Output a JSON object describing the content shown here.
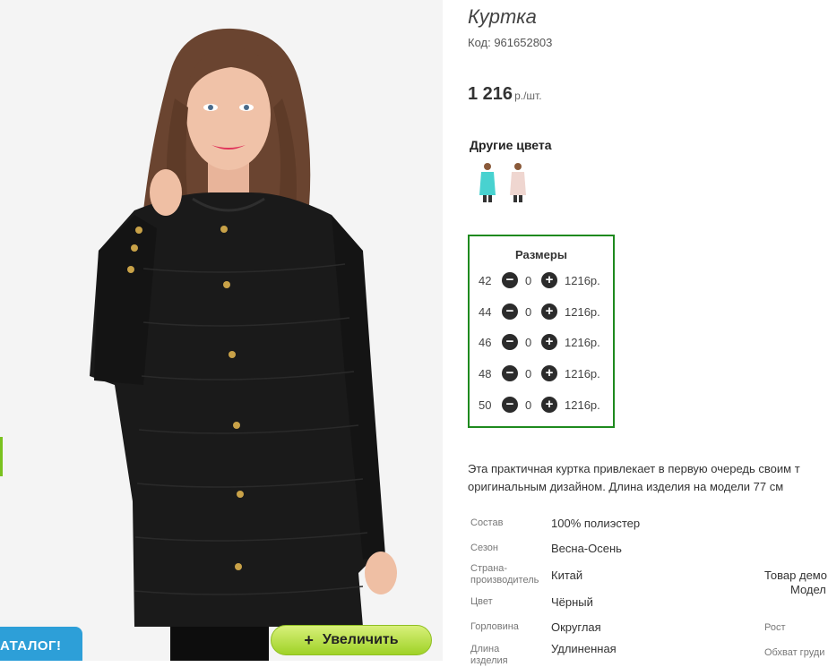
{
  "photo": {
    "catalog_badge": "АТАЛОГ!",
    "zoom_button": "Увеличить",
    "zoom_icon": "plus-icon"
  },
  "product": {
    "title": "Куртка",
    "code": "Код: 961652803",
    "price": "1 216",
    "price_unit": "р./шт."
  },
  "other_colors": {
    "title": "Другие цвета",
    "swatches": [
      "#48d2d0",
      "#efd6d0"
    ]
  },
  "sizes": {
    "title": "Размеры",
    "rows": [
      {
        "size": "42",
        "qty": "0",
        "price": "1216р."
      },
      {
        "size": "44",
        "qty": "0",
        "price": "1216р."
      },
      {
        "size": "46",
        "qty": "0",
        "price": "1216р."
      },
      {
        "size": "48",
        "qty": "0",
        "price": "1216р."
      },
      {
        "size": "50",
        "qty": "0",
        "price": "1216р."
      }
    ]
  },
  "description": {
    "line1": "Эта практичная куртка привлекает в первую очередь своим т",
    "line2": "оригинальным дизайном. Длина изделия на модели 77 см"
  },
  "attributes": [
    {
      "label": "Состав",
      "value": "100% полиэстер"
    },
    {
      "label": "Сезон",
      "value": "Весна-Осень"
    },
    {
      "label": "Страна-\nпроизводитель",
      "value": "Китай"
    },
    {
      "label": "Цвет",
      "value": "Чёрный"
    },
    {
      "label": "Горловина",
      "value": "Округлая"
    },
    {
      "label": "Длина\nизделия",
      "value": "Удлиненная"
    }
  ],
  "extra": {
    "line1": "Товар демо",
    "line2": "Модел",
    "height_label": "Рост",
    "chest_label": "Обхват груди"
  },
  "colors": {
    "sizes_border": "#1e8a1e",
    "zoom_button": "#b7e04a",
    "catalog_badge": "#2d9fd8"
  }
}
